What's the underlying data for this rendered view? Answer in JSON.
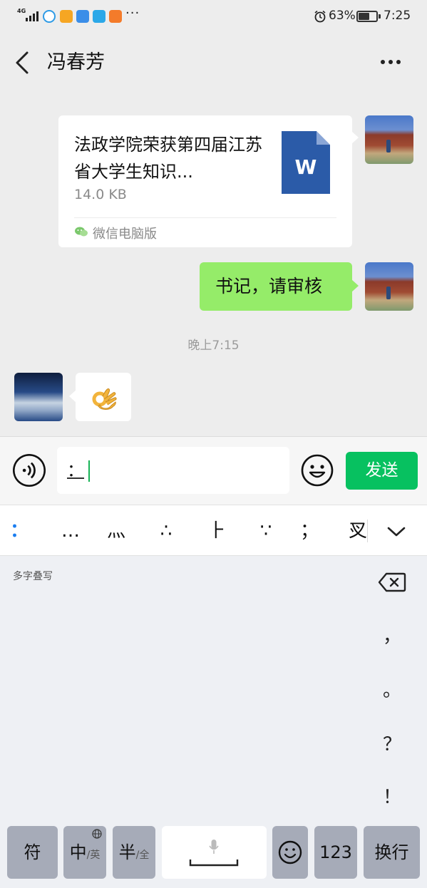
{
  "status_bar": {
    "network": "4G",
    "more_indicator": "···",
    "battery_percent": "63%",
    "battery_level": 0.63,
    "time": "7:25",
    "icons": [
      "signal-icon",
      "browser-app-icon",
      "orange-app-icon",
      "gallery-app-icon",
      "bulb-app-icon",
      "video-app-icon",
      "alarm-icon",
      "battery-icon"
    ]
  },
  "header": {
    "title": "冯春芳",
    "back_icon": "chevron-left-icon",
    "more_icon": "more-dots-icon"
  },
  "messages": {
    "file": {
      "name": "法政学院荣获第四届江苏省大学生知识...",
      "size": "14.0 KB",
      "file_icon_letter": "W",
      "source": "微信电脑版"
    },
    "text_sent": "书记，请审核",
    "timestamp": "晚上7:15",
    "received_emoji": "ok-hand-emoji"
  },
  "input_bar": {
    "value": "：",
    "send_label": "发送"
  },
  "candidates": [
    "：",
    "…",
    "灬",
    "∴",
    "⺊",
    "∵",
    "；",
    "㕚"
  ],
  "keyboard": {
    "handwriting_label": "多字叠写",
    "punctuation": [
      "，",
      "。",
      "？",
      "！"
    ],
    "keys": {
      "symbol": "符",
      "lang_main": "中",
      "lang_sub": "/英",
      "width_main": "半",
      "width_sub": "/全",
      "numbers": "123",
      "enter": "换行"
    }
  },
  "colors": {
    "accent_green": "#07c160",
    "bubble_green": "#95ec69",
    "word_blue": "#2b5ba8",
    "candidate_blue": "#1a7df0"
  }
}
